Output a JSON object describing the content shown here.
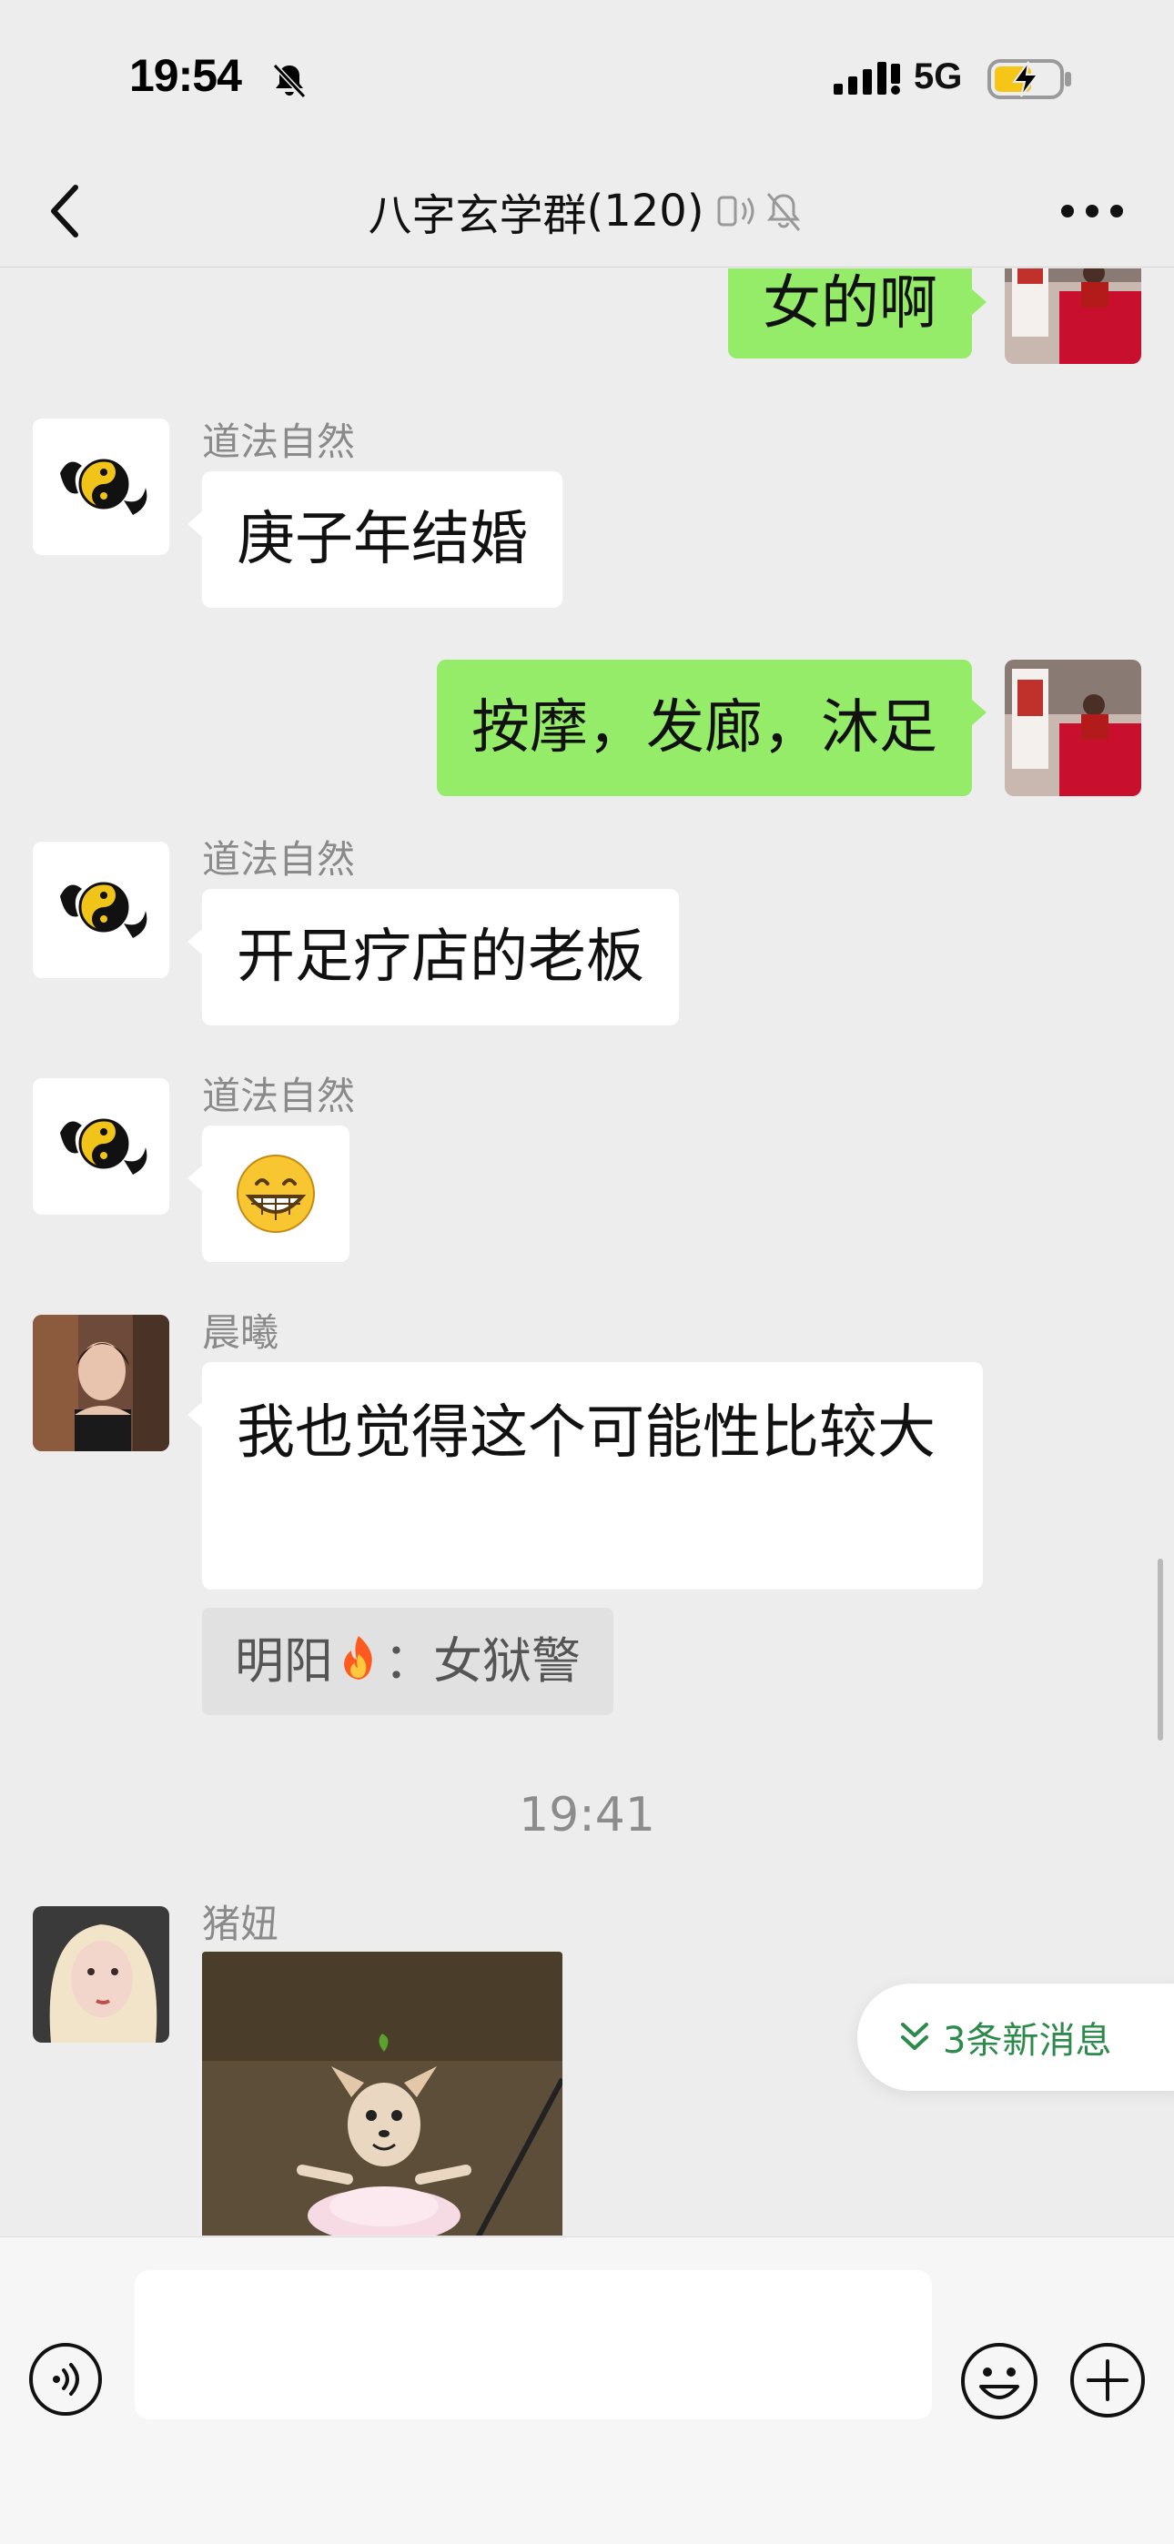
{
  "status_bar": {
    "time": "19:54",
    "network": "5G"
  },
  "nav": {
    "title": "八字玄学群",
    "member_count": "(120)"
  },
  "messages": [
    {
      "direction": "out",
      "text": "女的啊"
    },
    {
      "direction": "in",
      "sender": "道法自然",
      "text": "庚子年结婚"
    },
    {
      "direction": "out",
      "text": "按摩，发廊，沐足"
    },
    {
      "direction": "in",
      "sender": "道法自然",
      "text": "开足疗店的老板"
    },
    {
      "direction": "in",
      "sender": "道法自然",
      "emoji": "grinning-face-emoji"
    },
    {
      "direction": "in",
      "sender": "晨曦",
      "text": "我也觉得这个可能性比较大",
      "quote": {
        "author": "明阳",
        "separator": "：",
        "text": "女狱警"
      }
    },
    {
      "type": "timestamp",
      "text": "19:41"
    },
    {
      "direction": "in",
      "sender": "猪妞",
      "image": "chihuahua-ballerina-sticker"
    }
  ],
  "new_messages_pill": "3条新消息",
  "input": {
    "placeholder": "",
    "value": ""
  },
  "colors": {
    "background": "#ededed",
    "outgoing_bubble": "#95ec69",
    "incoming_bubble": "#ffffff",
    "accent_green": "#2c8a4b"
  }
}
